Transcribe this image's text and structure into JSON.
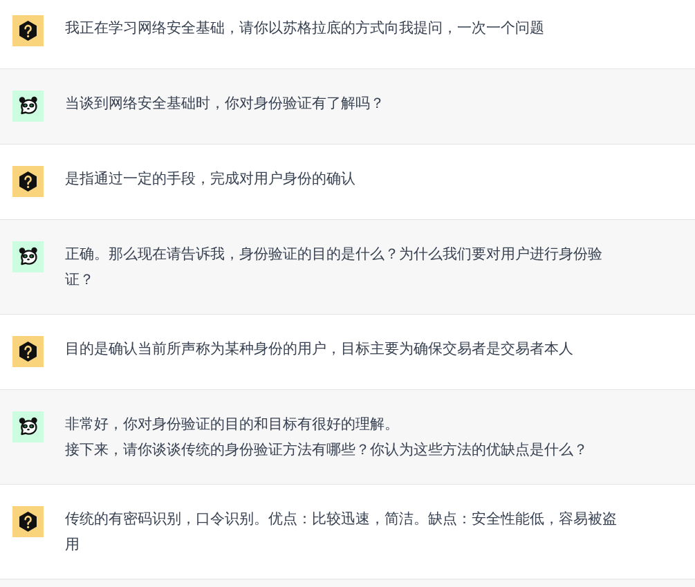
{
  "messages": [
    {
      "kind": "user",
      "lines": [
        "我正在学习网络安全基础，请你以苏格拉底的方式向我提问，一次一个问题"
      ]
    },
    {
      "kind": "assistant",
      "lines": [
        "当谈到网络安全基础时，你对身份验证有了解吗？"
      ]
    },
    {
      "kind": "user",
      "lines": [
        "是指通过一定的手段，完成对用户身份的确认"
      ]
    },
    {
      "kind": "assistant",
      "lines": [
        "正确。那么现在请告诉我，身份验证的目的是什么？为什么我们要对用户进行身份验证？"
      ]
    },
    {
      "kind": "user",
      "lines": [
        "目的是确认当前所声称为某种身份的用户，目标主要为确保交易者是交易者本人"
      ]
    },
    {
      "kind": "assistant",
      "lines": [
        "非常好，你对身份验证的目的和目标有很好的理解。",
        "接下来，请你谈谈传统的身份验证方法有哪些？你认为这些方法的优缺点是什么？"
      ]
    },
    {
      "kind": "user",
      "lines": [
        "传统的有密码识别，口令识别。优点：比较迅速，简洁。缺点：安全性能低，容易被盗用"
      ]
    }
  ]
}
